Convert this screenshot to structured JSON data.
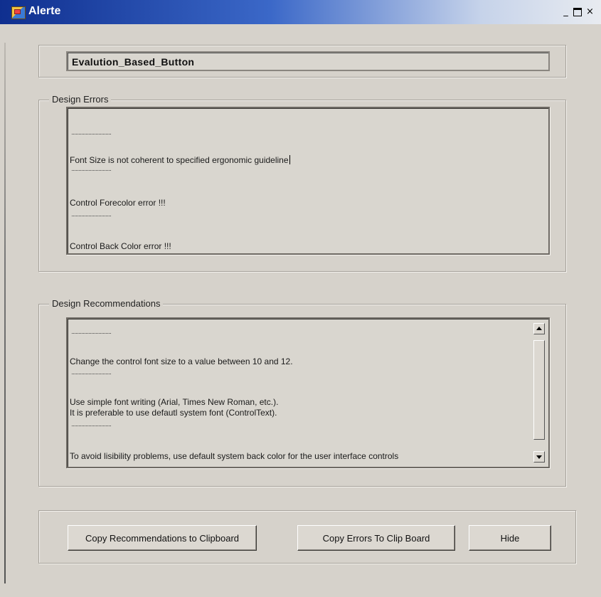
{
  "window": {
    "title": "Alerte",
    "controls": {
      "minimize": "_",
      "maximize": "□",
      "close": "×"
    }
  },
  "control_name": "Evalution_Based_Button",
  "design_errors": {
    "label": "Design Errors",
    "separator": "-------------",
    "lines": [
      "Font Size is not coherent to specified ergonomic guideline",
      "Control Forecolor error !!!",
      "Control Back Color error !!!"
    ]
  },
  "design_recommendations": {
    "label": "Design Recommendations",
    "separator": "-------------",
    "lines": [
      "Change the control font size to a value between 10 and 12.",
      "Use simple font writing (Arial, Times New Roman, etc.).",
      "It is preferable to use defautl system font (ControlText).",
      "To avoid lisibility problems, use default system back color for the user interface controls"
    ]
  },
  "buttons": {
    "copy_recommendations": "Copy Recommendations to Clipboard",
    "copy_errors": "Copy Errors To Clip Board",
    "hide": "Hide"
  },
  "colors": {
    "titlebar_start": "#0f2f8f",
    "titlebar_end": "#e8ebf0",
    "window_background": "#d6d2cb"
  }
}
